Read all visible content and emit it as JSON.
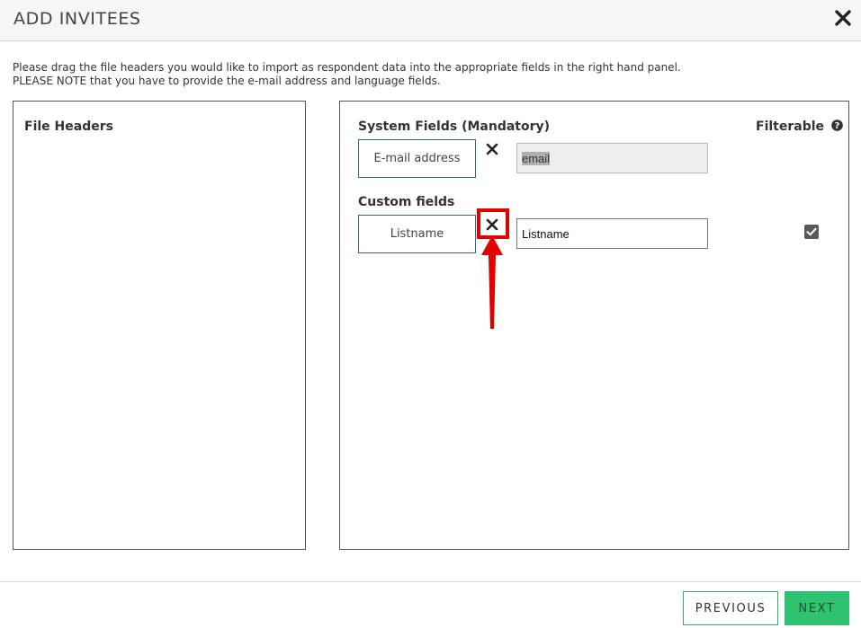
{
  "dialog": {
    "title": "ADD INVITEES"
  },
  "instructions": {
    "line1": "Please drag the file headers you would like to import as respondent data into the appropriate fields in the right hand panel.",
    "line2": "PLEASE NOTE that you have to provide the e-mail address and language fields."
  },
  "file_headers": {
    "heading": "File Headers"
  },
  "mapping": {
    "system_heading": "System Fields (Mandatory)",
    "filterable_label": "Filterable",
    "custom_heading": "Custom fields",
    "system_fields": [
      {
        "label": "E-mail address",
        "value": "email"
      }
    ],
    "custom_fields": [
      {
        "label": "Listname",
        "value": "Listname",
        "filterable": true
      }
    ]
  },
  "footer": {
    "previous_label": "PREVIOUS",
    "next_label": "NEXT"
  },
  "colors": {
    "accent_green": "#2ec271",
    "field_border": "#2d6a7f",
    "annotation_red": "#e00000"
  }
}
